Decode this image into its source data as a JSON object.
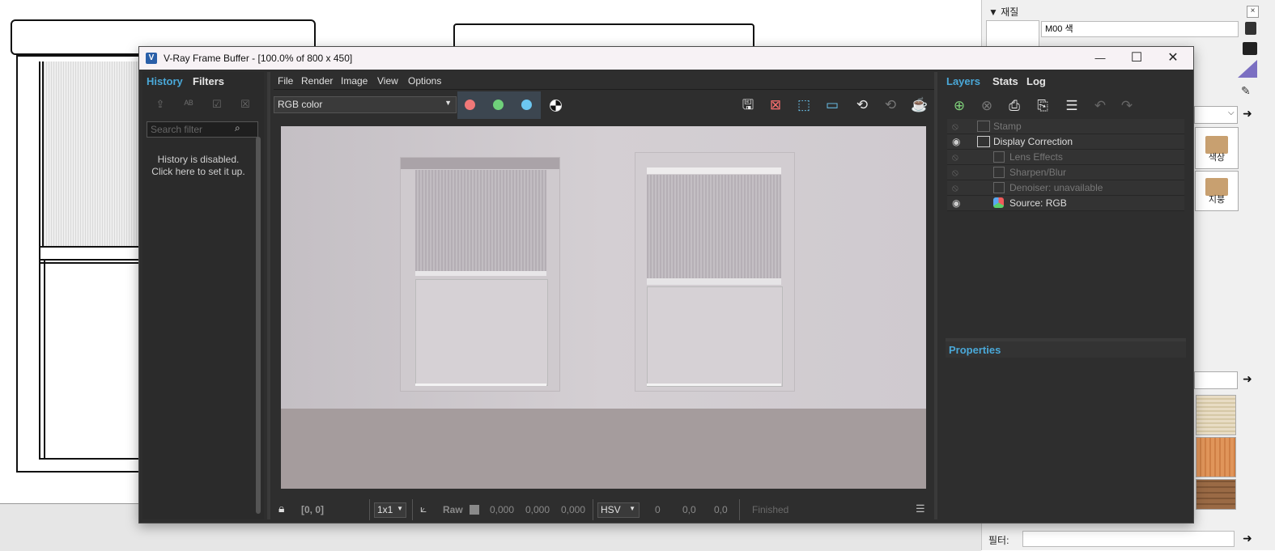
{
  "background_app": {
    "material_panel": {
      "title": "▼ 재질",
      "close": "×",
      "material_name": "M00 색",
      "tiles": [
        {
          "label": "색상"
        },
        {
          "label": "지붕"
        }
      ],
      "filter_label": "필터:"
    }
  },
  "vfb": {
    "title": "V-Ray Frame Buffer - [100.0% of 800 x 450]",
    "window_buttons": {
      "minimize": "—",
      "maximize": "☐",
      "close": "✕"
    },
    "left_panel": {
      "tabs": [
        {
          "label": "History"
        },
        {
          "label": "Filters"
        }
      ],
      "search_placeholder": "Search filter",
      "disabled_message_line1": "History is disabled.",
      "disabled_message_line2": "Click here to set it up."
    },
    "menu": [
      {
        "label": "File"
      },
      {
        "label": "Render"
      },
      {
        "label": "Image"
      },
      {
        "label": "View"
      },
      {
        "label": "Options"
      }
    ],
    "channel_select": "RGB color",
    "channel_colors": {
      "red": "#f07878",
      "green": "#6fd07a",
      "blue": "#6cc6f0"
    },
    "status_bar": {
      "coords": "[0, 0]",
      "sample_size": "1x1",
      "raw_label": "Raw",
      "raw_values": [
        "0,000",
        "0,000",
        "0,000"
      ],
      "color_mode": "HSV",
      "hsv_values": [
        "0",
        "0,0",
        "0,0"
      ],
      "state": "Finished"
    },
    "right_panel": {
      "tabs": [
        {
          "label": "Layers"
        },
        {
          "label": "Stats"
        },
        {
          "label": "Log"
        }
      ],
      "layers": [
        {
          "label": "Stamp",
          "enabled": false
        },
        {
          "label": "Display Correction",
          "enabled": true
        },
        {
          "label": "Lens Effects",
          "enabled": false
        },
        {
          "label": "Sharpen/Blur",
          "enabled": false
        },
        {
          "label": "Denoiser: unavailable",
          "enabled": false
        },
        {
          "label": "Source: RGB",
          "enabled": true
        }
      ],
      "properties_label": "Properties"
    },
    "accent_color": "#4aa8d8"
  }
}
